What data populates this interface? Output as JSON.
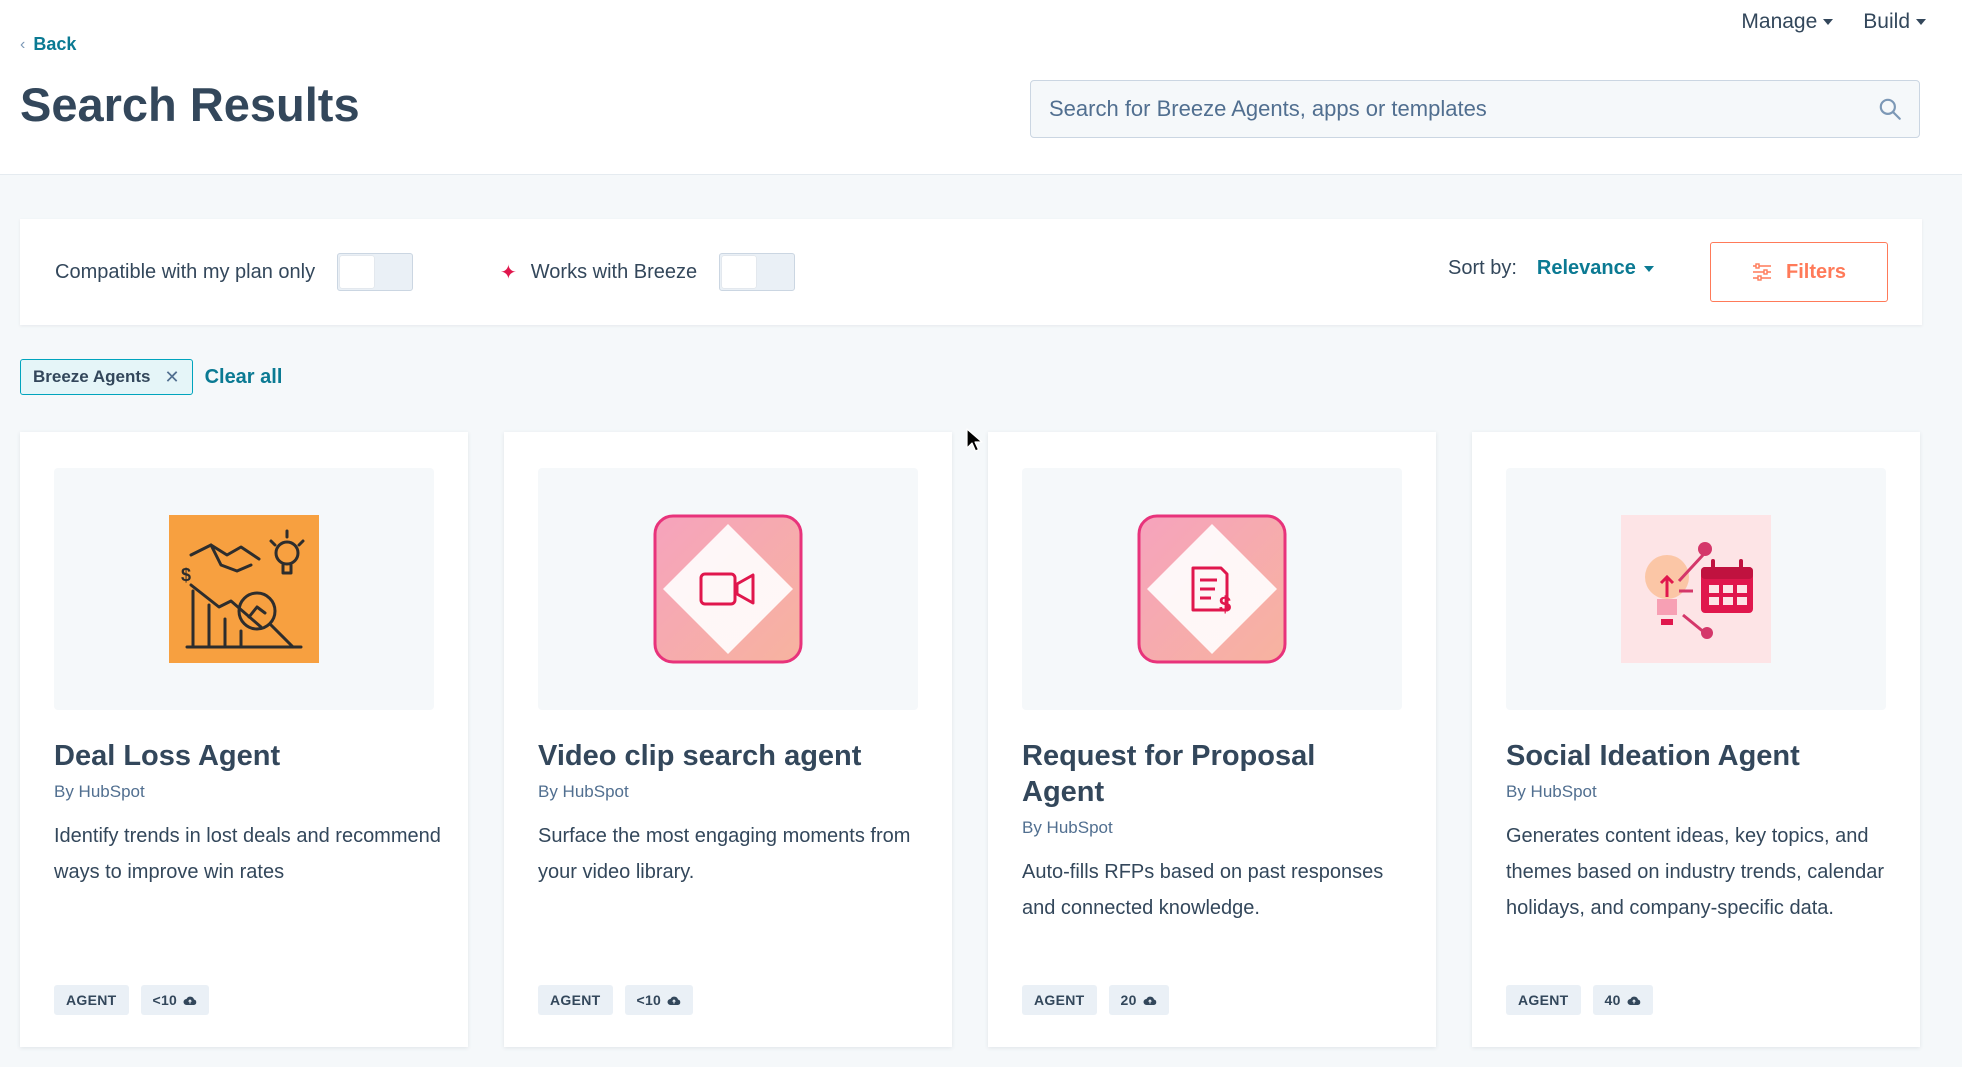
{
  "header": {
    "nav": [
      {
        "label": "Manage"
      },
      {
        "label": "Build"
      }
    ],
    "back_label": "Back",
    "title": "Search Results",
    "search_placeholder": "Search for Breeze Agents, apps or templates"
  },
  "filters": {
    "compatible_label": "Compatible with my plan only",
    "compatible_on": false,
    "breeze_label": "Works with Breeze",
    "breeze_on": false,
    "sort_label": "Sort by:",
    "sort_value": "Relevance",
    "filters_button": "Filters"
  },
  "active_filters": {
    "chips": [
      {
        "label": "Breeze Agents"
      }
    ],
    "clear_all": "Clear all"
  },
  "cards": [
    {
      "title": "Deal Loss Agent",
      "by": "By HubSpot",
      "description": "Identify trends in lost deals and recommend ways to improve win rates",
      "tags": [
        "AGENT",
        "<10"
      ],
      "icon": "deal-loss-icon"
    },
    {
      "title": "Video clip search agent",
      "by": "By HubSpot",
      "description": "Surface the most engaging moments from your video library.",
      "tags": [
        "AGENT",
        "<10"
      ],
      "icon": "video-camera-icon"
    },
    {
      "title": "Request for Proposal Agent",
      "by": "By HubSpot",
      "description": "Auto-fills RFPs based on past responses and connected knowledge.",
      "tags": [
        "AGENT",
        "20"
      ],
      "icon": "document-dollar-icon"
    },
    {
      "title": "Social Ideation Agent",
      "by": "By HubSpot",
      "description": "Generates content ideas, key topics, and themes based on industry trends, calendar holidays, and company-specific data.",
      "tags": [
        "AGENT",
        "40"
      ],
      "icon": "lightbulb-calendar-icon"
    }
  ],
  "colors": {
    "accent_link": "#0b7a93",
    "filters_orange": "#ff7a59",
    "text": "#33475b",
    "breeze_sparkle": "#e0174d"
  }
}
